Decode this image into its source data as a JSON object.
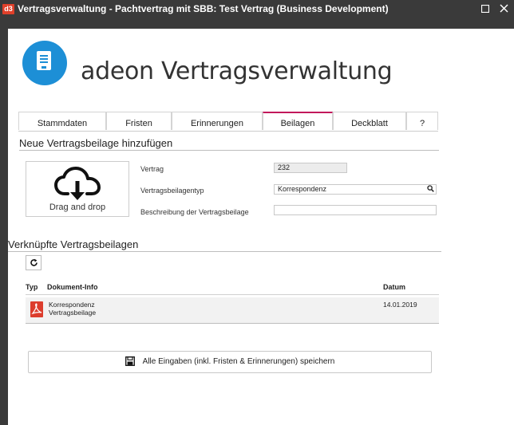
{
  "window": {
    "logo_text": "d3",
    "title": "Vertragsverwaltung - Pachtvertrag mit SBB: Test Vertrag (Business Development)"
  },
  "app": {
    "title": "adeon Vertragsverwaltung"
  },
  "tabs": [
    {
      "label": "Stammdaten"
    },
    {
      "label": "Fristen"
    },
    {
      "label": "Erinnerungen"
    },
    {
      "label": "Beilagen",
      "active": true
    },
    {
      "label": "Deckblatt"
    },
    {
      "label": "?"
    }
  ],
  "new_attachment": {
    "section_title": "Neue Vertragsbeilage hinzufügen",
    "dropzone_label": "Drag and drop",
    "fields": {
      "contract_label": "Vertrag",
      "contract_value": "232",
      "type_label": "Vertragsbeilagentyp",
      "type_value": "Korrespondenz",
      "description_label": "Beschreibung der Vertragsbeilage",
      "description_value": ""
    }
  },
  "linked": {
    "section_title": "Verknüpfte Vertragsbeilagen",
    "columns": [
      "Typ",
      "Dokument-Info",
      "Datum"
    ],
    "rows": [
      {
        "type_icon": "pdf-icon",
        "info_line1": "Korrespondenz",
        "info_line2": "Vertragsbeilage",
        "date": "14.01.2019"
      }
    ]
  },
  "save_button": {
    "label": "Alle Eingaben (inkl. Fristen & Erinnerungen) speichern"
  },
  "colors": {
    "titlebar": "#3a3a3a",
    "accent": "#c2185b",
    "logo": "#1d8fd6",
    "pdf": "#dc3d2d"
  }
}
